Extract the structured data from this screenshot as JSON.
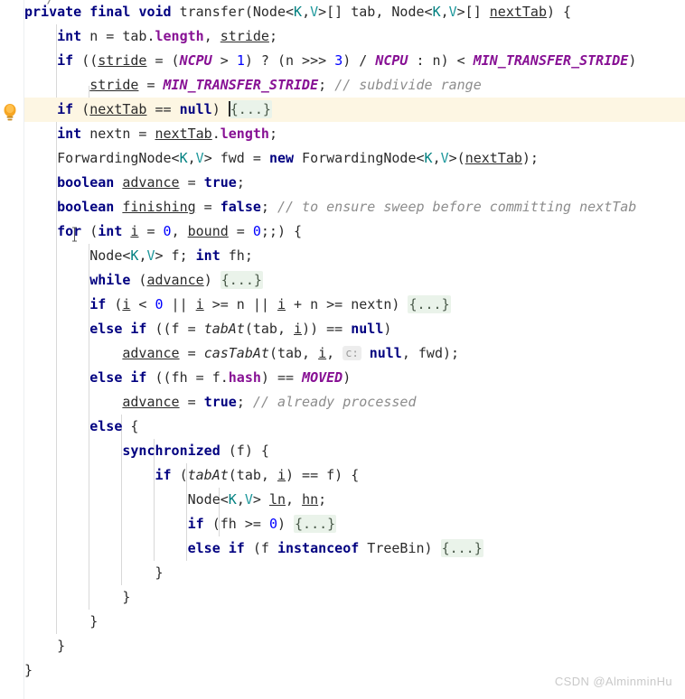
{
  "app": {
    "kind": "code-editor",
    "language": "Java",
    "theme": "light"
  },
  "gutter": {
    "bulb_icon": "lightbulb-icon",
    "bulb_color": "#f5a623",
    "bulb_tooltip": "Show Context Actions"
  },
  "editor": {
    "top_fragment": "/",
    "caret_line": 5,
    "highlight_color": "#fdf6e3",
    "fold_placeholder": "{...}",
    "fold_bg": "#eaf3ea",
    "hint_chip": "c:",
    "font_size_px": 15,
    "line_height_px": 27
  },
  "colors": {
    "keyword": "#000080",
    "number": "#0000ff",
    "field": "#871094",
    "static_final": "#871094",
    "comment": "#8c8c8c",
    "generic_k": "#008080",
    "generic_v": "#20999d",
    "text": "#2b2b2b",
    "fold_text": "#4a5a4a",
    "hint_text": "#9a9a9a",
    "highlight": "#fdf6e3",
    "watermark": "#c9c9c9"
  },
  "code": {
    "method_signature": "private final void transfer(Node<K,V>[] tab, Node<K,V>[] nextTab) {",
    "lines": [
      "private final void transfer(Node<K,V>[] tab, Node<K,V>[] nextTab) {",
      "    int n = tab.length, stride;",
      "    if ((stride = (NCPU > 1) ? (n >>> 3) / NCPU : n) < MIN_TRANSFER_STRIDE)",
      "        stride = MIN_TRANSFER_STRIDE; // subdivide range",
      "    if (nextTab == null) {...}",
      "    int nextn = nextTab.length;",
      "    ForwardingNode<K,V> fwd = new ForwardingNode<K,V>(nextTab);",
      "    boolean advance = true;",
      "    boolean finishing = false; // to ensure sweep before committing nextTab",
      "    for (int i = 0, bound = 0;;) {",
      "        Node<K,V> f; int fh;",
      "        while (advance) {...}",
      "        if (i < 0 || i >= n || i + n >= nextn) {...}",
      "        else if ((f = tabAt(tab, i)) == null)",
      "            advance = casTabAt(tab, i, c: null, fwd);",
      "        else if ((fh = f.hash) == MOVED)",
      "            advance = true; // already processed",
      "        else {",
      "            synchronized (f) {",
      "                if (tabAt(tab, i) == f) {",
      "                    Node<K,V> ln, hn;",
      "                    if (fh >= 0) {...}",
      "                    else if (f instanceof TreeBin) {...}",
      "                }",
      "            }",
      "        }",
      "    }",
      "}"
    ],
    "comments": [
      "// subdivide range",
      "// to ensure sweep before committing nextTab",
      "// already processed"
    ],
    "identifiers": {
      "method": "transfer",
      "static_finals": [
        "NCPU",
        "MIN_TRANSFER_STRIDE",
        "MOVED"
      ],
      "static_methods": [
        "tabAt",
        "casTabAt"
      ],
      "locals": [
        "n",
        "stride",
        "nextn",
        "fwd",
        "advance",
        "finishing",
        "i",
        "bound",
        "f",
        "fh",
        "ln",
        "hn"
      ],
      "params": [
        "tab",
        "nextTab"
      ],
      "types": [
        "Node",
        "ForwardingNode",
        "TreeBin",
        "K",
        "V"
      ],
      "fields": [
        "length",
        "hash"
      ]
    }
  },
  "watermark": {
    "text": "CSDN @AlminminHu"
  }
}
